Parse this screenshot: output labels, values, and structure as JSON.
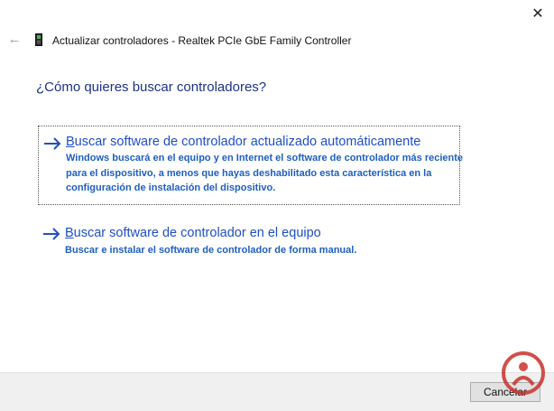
{
  "window": {
    "title": "Actualizar controladores - Realtek PCIe GbE Family Controller",
    "close_symbol": "✕",
    "back_symbol": "←",
    "icons": {
      "close": "close-icon",
      "back": "back-arrow-icon",
      "device": "network-device-icon"
    }
  },
  "main": {
    "question": "¿Cómo quieres buscar controladores?",
    "options": [
      {
        "accel": "B",
        "title_rest": "uscar software de controlador actualizado automáticamente",
        "description": "Windows buscará en el equipo y en Internet el software de controlador más reciente para el dispositivo, a menos que hayas deshabilitado esta característica en la configuración de instalación del dispositivo.",
        "icon": "arrow-right-icon"
      },
      {
        "accel": "B",
        "title_rest": "uscar software de controlador en el equipo",
        "description": "Buscar e instalar el software de controlador de forma manual.",
        "icon": "arrow-right-icon"
      }
    ]
  },
  "footer": {
    "cancel_label": "Cancelar"
  },
  "colors": {
    "link": "#1f4fc2",
    "heading": "#1e3287",
    "footer_bg": "#f0f0f0",
    "watermark": "#c9302c"
  }
}
